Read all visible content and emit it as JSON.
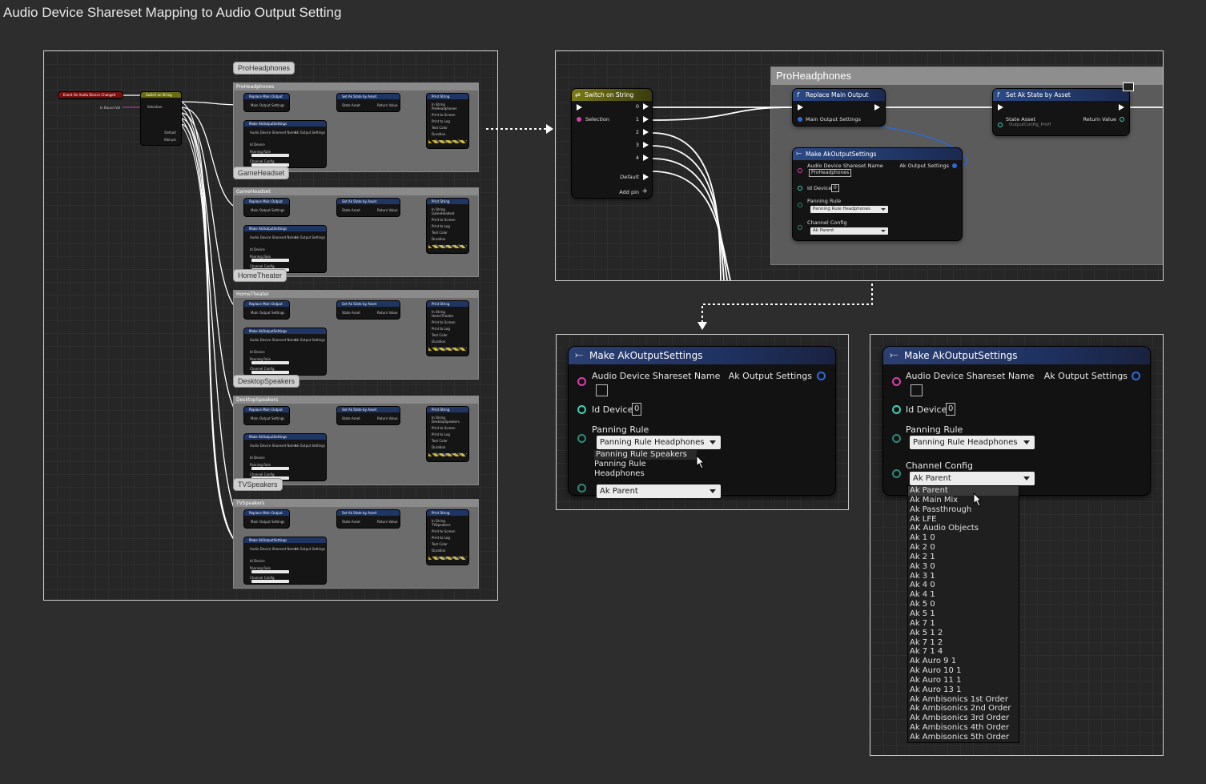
{
  "page_title": "Audio Device Shareset Mapping to Audio Output Setting",
  "colors": {
    "switch_head": "#6b6b10",
    "func_head": "#1f3563",
    "event_head": "#7a1010",
    "exec": "#ffffff",
    "string_pin": "#d63fae",
    "int_pin": "#3fd3b8",
    "struct_pin": "#2a6ad8"
  },
  "overview": {
    "event_label": "Event On Audio Device Changed",
    "switch_label": "Switch on String",
    "in_string_label": "In Bound Val",
    "selection_label": "Selection",
    "default_label": "Default",
    "add_pin_label": "Add pin",
    "groups": [
      {
        "bubble": "ProHeadphones",
        "bar": "ProHeadphones",
        "print": "ProHeadphones"
      },
      {
        "bubble": "GameHeadset",
        "bar": "GameHeadset",
        "print": "GameHeadset"
      },
      {
        "bubble": "HomeTheater",
        "bar": "HomeTheater",
        "print": "HomeTheater"
      },
      {
        "bubble": "DesktopSpeakers",
        "bar": "DesktopSpeakers",
        "print": "DesktopSpeakers"
      },
      {
        "bubble": "TVSpeakers",
        "bar": "TVSpeakers",
        "print": "TVSpeakers"
      }
    ],
    "mini": {
      "replace": "Replace Main Output",
      "main_output": "Main Output Settings",
      "set_state": "Set Ak State by Asset",
      "state_asset": "State Asset",
      "return_value": "Return Value",
      "print": "Print String",
      "make": "Make AkOutputSettings",
      "shareset": "Audio Device Shareset Name",
      "ak_out": "Ak Output Settings",
      "id_device": "Id Device",
      "panning": "Panning Rule",
      "channel": "Channel Config",
      "in_string": "In String",
      "print_screen": "Print to Screen",
      "print_log": "Print to Log",
      "text_color": "Text Color",
      "duration": "Duration",
      "dev_only": "Development Only"
    }
  },
  "detail": {
    "comment": "ProHeadphones",
    "switch": {
      "title": "Switch on String",
      "selection": "Selection",
      "outs": [
        "0",
        "1",
        "2",
        "3",
        "4"
      ],
      "default": "Default",
      "add_pin": "Add pin"
    },
    "replace": {
      "title": "Replace Main Output",
      "input": "Main Output Settings"
    },
    "set_state": {
      "title": "Set Ak State by Asset",
      "state_asset": "State Asset",
      "asset_value": "OutputConfig_ProH",
      "return_value": "Return Value"
    },
    "make": {
      "title": "Make AkOutputSettings",
      "shareset": "Audio Device Shareset Name",
      "shareset_value": "ProHeadphones",
      "ak_out": "Ak Output Settings",
      "id_device": "Id Device",
      "id_value": "0",
      "panning": "Panning Rule",
      "panning_value": "Panning Rule Headphones",
      "channel": "Channel Config",
      "channel_value": "Ak Parent"
    }
  },
  "zoom_left": {
    "title": "Make AkOutputSettings",
    "shareset": "Audio Device Shareset Name",
    "ak_out": "Ak Output Settings",
    "id_device": "Id Device",
    "id_value": "0",
    "panning": "Panning Rule",
    "panning_value": "Panning Rule Headphones",
    "panning_options": [
      "Panning Rule Speakers",
      "Panning Rule Headphones"
    ],
    "channel_value": "Ak Parent"
  },
  "zoom_right": {
    "title": "Make AkOutputSettings",
    "shareset": "Audio Device Shareset Name",
    "ak_out": "Ak Output Settings",
    "id_device": "Id Device",
    "id_value": "0",
    "panning": "Panning Rule",
    "panning_value": "Panning Rule Headphones",
    "channel": "Channel Config",
    "channel_value": "Ak Parent",
    "channel_options": [
      "Ak Parent",
      "Ak Main Mix",
      "Ak Passthrough",
      "Ak LFE",
      "AK Audio Objects",
      "Ak 1 0",
      "Ak 2 0",
      "Ak 2 1",
      "Ak 3 0",
      "Ak 3 1",
      "Ak 4 0",
      "Ak 4 1",
      "Ak 5 0",
      "Ak 5 1",
      "Ak 7 1",
      "Ak 5 1 2",
      "Ak 7 1 2",
      "Ak 7 1 4",
      "Ak Auro 9 1",
      "Ak Auro 10 1",
      "Ak Auro 11 1",
      "Ak Auro 13 1",
      "Ak Ambisonics 1st Order",
      "Ak Ambisonics 2nd Order",
      "Ak Ambisonics 3rd Order",
      "Ak Ambisonics 4th Order",
      "Ak Ambisonics 5th Order"
    ]
  }
}
